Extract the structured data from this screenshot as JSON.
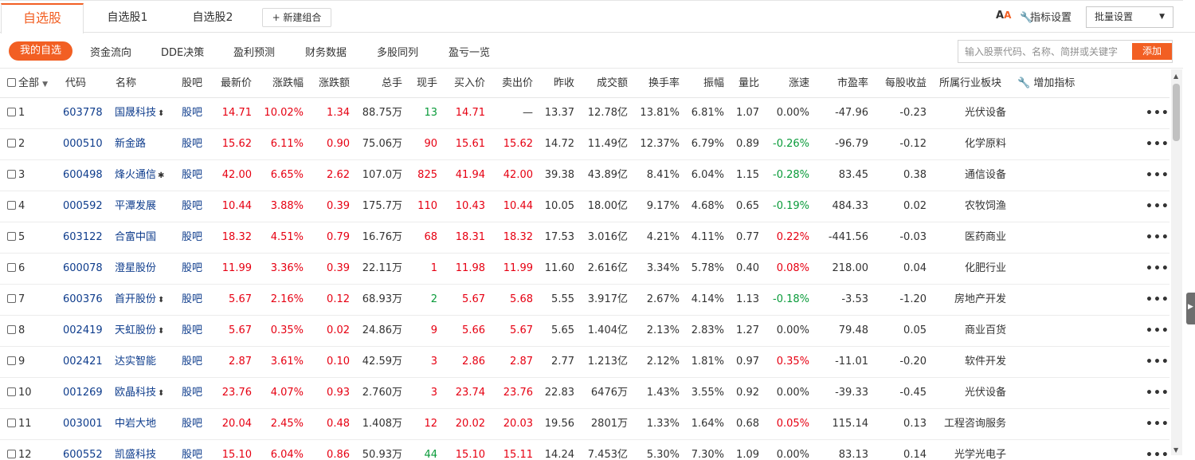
{
  "tabs": {
    "active": "自选股",
    "tab2": "自选股1",
    "tab3": "自选股2",
    "new_group": "+ 新建组合"
  },
  "toolbar": {
    "font_a1": "A",
    "font_a2": "A",
    "indicator_settings": "指标设置",
    "batch_settings": "批量设置"
  },
  "subtabs": {
    "my_watchlist": "我的自选",
    "items": [
      "资金流向",
      "DDE决策",
      "盈利预测",
      "财务数据",
      "多股同列",
      "盈亏一览"
    ]
  },
  "search": {
    "placeholder": "输入股票代码、名称、简拼或关键字",
    "add_label": "添加"
  },
  "header": {
    "all": "全部",
    "code": "代码",
    "name": "名称",
    "bar": "股吧",
    "price": "最新价",
    "chg_pct": "涨跌幅",
    "chg_amt": "涨跌额",
    "volume": "总手",
    "cur_hand": "现手",
    "bid": "买入价",
    "ask": "卖出价",
    "prev_close": "昨收",
    "turnover_amt": "成交额",
    "turnover_rate": "换手率",
    "amplitude": "振幅",
    "vol_ratio": "量比",
    "speed": "涨速",
    "pe": "市盈率",
    "eps": "每股收益",
    "industry": "所属行业板块",
    "add_indicator": "增加指标"
  },
  "colors": {
    "accent": "#f25f23",
    "up": "#e60012",
    "down": "#0a9b3a",
    "link": "#0e3c8c"
  },
  "rows": [
    {
      "idx": "1",
      "code": "603778",
      "name": "国晟科技",
      "flag": "⬍",
      "bar": "股吧",
      "price": "14.71",
      "chg_pct": "10.02%",
      "chg_amt": "1.34",
      "volume": "88.75万",
      "cur": "13",
      "cur_c": "green",
      "bid": "14.71",
      "ask": "—",
      "ask_c": "gray",
      "prev": "13.37",
      "amount": "12.78亿",
      "turn": "13.81%",
      "amp": "6.81%",
      "vr": "1.07",
      "speed": "0.00%",
      "speed_c": "gray",
      "pe": "-47.96",
      "eps": "-0.23",
      "industry": "光伏设备",
      "price_c": "red"
    },
    {
      "idx": "2",
      "code": "000510",
      "name": "新金路",
      "flag": "",
      "bar": "股吧",
      "price": "15.62",
      "chg_pct": "6.11%",
      "chg_amt": "0.90",
      "volume": "75.06万",
      "cur": "90",
      "cur_c": "red",
      "bid": "15.61",
      "ask": "15.62",
      "ask_c": "red",
      "prev": "14.72",
      "amount": "11.49亿",
      "turn": "12.37%",
      "amp": "6.79%",
      "vr": "0.89",
      "speed": "-0.26%",
      "speed_c": "green",
      "pe": "-96.79",
      "eps": "-0.12",
      "industry": "化学原料",
      "price_c": "red"
    },
    {
      "idx": "3",
      "code": "600498",
      "name": "烽火通信",
      "flag": "✱",
      "bar": "股吧",
      "price": "42.00",
      "chg_pct": "6.65%",
      "chg_amt": "2.62",
      "volume": "107.0万",
      "cur": "825",
      "cur_c": "red",
      "bid": "41.94",
      "ask": "42.00",
      "ask_c": "red",
      "prev": "39.38",
      "amount": "43.89亿",
      "turn": "8.41%",
      "amp": "6.04%",
      "vr": "1.15",
      "speed": "-0.28%",
      "speed_c": "green",
      "pe": "83.45",
      "eps": "0.38",
      "industry": "通信设备",
      "price_c": "red"
    },
    {
      "idx": "4",
      "code": "000592",
      "name": "平潭发展",
      "flag": "",
      "bar": "股吧",
      "price": "10.44",
      "chg_pct": "3.88%",
      "chg_amt": "0.39",
      "volume": "175.7万",
      "cur": "110",
      "cur_c": "red",
      "bid": "10.43",
      "ask": "10.44",
      "ask_c": "red",
      "prev": "10.05",
      "amount": "18.00亿",
      "turn": "9.17%",
      "amp": "4.68%",
      "vr": "0.65",
      "speed": "-0.19%",
      "speed_c": "green",
      "pe": "484.33",
      "eps": "0.02",
      "industry": "农牧饲渔",
      "price_c": "red"
    },
    {
      "idx": "5",
      "code": "603122",
      "name": "合富中国",
      "flag": "",
      "bar": "股吧",
      "price": "18.32",
      "chg_pct": "4.51%",
      "chg_amt": "0.79",
      "volume": "16.76万",
      "cur": "68",
      "cur_c": "red",
      "bid": "18.31",
      "ask": "18.32",
      "ask_c": "red",
      "prev": "17.53",
      "amount": "3.016亿",
      "turn": "4.21%",
      "amp": "4.11%",
      "vr": "0.77",
      "speed": "0.22%",
      "speed_c": "red",
      "pe": "-441.56",
      "eps": "-0.03",
      "industry": "医药商业",
      "price_c": "red"
    },
    {
      "idx": "6",
      "code": "600078",
      "name": "澄星股份",
      "flag": "",
      "bar": "股吧",
      "price": "11.99",
      "chg_pct": "3.36%",
      "chg_amt": "0.39",
      "volume": "22.11万",
      "cur": "1",
      "cur_c": "red",
      "bid": "11.98",
      "ask": "11.99",
      "ask_c": "red",
      "prev": "11.60",
      "amount": "2.616亿",
      "turn": "3.34%",
      "amp": "5.78%",
      "vr": "0.40",
      "speed": "0.08%",
      "speed_c": "red",
      "pe": "218.00",
      "eps": "0.04",
      "industry": "化肥行业",
      "price_c": "red"
    },
    {
      "idx": "7",
      "code": "600376",
      "name": "首开股份",
      "flag": "⬍",
      "bar": "股吧",
      "price": "5.67",
      "chg_pct": "2.16%",
      "chg_amt": "0.12",
      "volume": "68.93万",
      "cur": "2",
      "cur_c": "green",
      "bid": "5.67",
      "ask": "5.68",
      "ask_c": "red",
      "prev": "5.55",
      "amount": "3.917亿",
      "turn": "2.67%",
      "amp": "4.14%",
      "vr": "1.13",
      "speed": "-0.18%",
      "speed_c": "green",
      "pe": "-3.53",
      "eps": "-1.20",
      "industry": "房地产开发",
      "price_c": "red"
    },
    {
      "idx": "8",
      "code": "002419",
      "name": "天虹股份",
      "flag": "⬍",
      "bar": "股吧",
      "price": "5.67",
      "chg_pct": "0.35%",
      "chg_amt": "0.02",
      "volume": "24.86万",
      "cur": "9",
      "cur_c": "red",
      "bid": "5.66",
      "ask": "5.67",
      "ask_c": "red",
      "prev": "5.65",
      "amount": "1.404亿",
      "turn": "2.13%",
      "amp": "2.83%",
      "vr": "1.27",
      "speed": "0.00%",
      "speed_c": "gray",
      "pe": "79.48",
      "eps": "0.05",
      "industry": "商业百货",
      "price_c": "red"
    },
    {
      "idx": "9",
      "code": "002421",
      "name": "达实智能",
      "flag": "",
      "bar": "股吧",
      "price": "2.87",
      "chg_pct": "3.61%",
      "chg_amt": "0.10",
      "volume": "42.59万",
      "cur": "3",
      "cur_c": "red",
      "bid": "2.86",
      "ask": "2.87",
      "ask_c": "red",
      "prev": "2.77",
      "amount": "1.213亿",
      "turn": "2.12%",
      "amp": "1.81%",
      "vr": "0.97",
      "speed": "0.35%",
      "speed_c": "red",
      "pe": "-11.01",
      "eps": "-0.20",
      "industry": "软件开发",
      "price_c": "red"
    },
    {
      "idx": "10",
      "code": "001269",
      "name": "欧晶科技",
      "flag": "⬍",
      "bar": "股吧",
      "price": "23.76",
      "chg_pct": "4.07%",
      "chg_amt": "0.93",
      "volume": "2.760万",
      "cur": "3",
      "cur_c": "red",
      "bid": "23.74",
      "ask": "23.76",
      "ask_c": "red",
      "prev": "22.83",
      "amount": "6476万",
      "turn": "1.43%",
      "amp": "3.55%",
      "vr": "0.92",
      "speed": "0.00%",
      "speed_c": "gray",
      "pe": "-39.33",
      "eps": "-0.45",
      "industry": "光伏设备",
      "price_c": "red"
    },
    {
      "idx": "11",
      "code": "003001",
      "name": "中岩大地",
      "flag": "",
      "bar": "股吧",
      "price": "20.04",
      "chg_pct": "2.45%",
      "chg_amt": "0.48",
      "volume": "1.408万",
      "cur": "12",
      "cur_c": "red",
      "bid": "20.02",
      "ask": "20.03",
      "ask_c": "red",
      "prev": "19.56",
      "amount": "2801万",
      "turn": "1.33%",
      "amp": "1.64%",
      "vr": "0.68",
      "speed": "0.05%",
      "speed_c": "red",
      "pe": "115.14",
      "eps": "0.13",
      "industry": "工程咨询服务",
      "price_c": "red"
    },
    {
      "idx": "12",
      "code": "600552",
      "name": "凯盛科技",
      "flag": "",
      "bar": "股吧",
      "price": "15.10",
      "chg_pct": "6.04%",
      "chg_amt": "0.86",
      "volume": "50.93万",
      "cur": "44",
      "cur_c": "green",
      "bid": "15.10",
      "ask": "15.11",
      "ask_c": "red",
      "prev": "14.24",
      "amount": "7.453亿",
      "turn": "5.30%",
      "amp": "7.30%",
      "vr": "1.09",
      "speed": "0.00%",
      "speed_c": "gray",
      "pe": "83.13",
      "eps": "0.14",
      "industry": "光学光电子",
      "price_c": "red"
    }
  ]
}
